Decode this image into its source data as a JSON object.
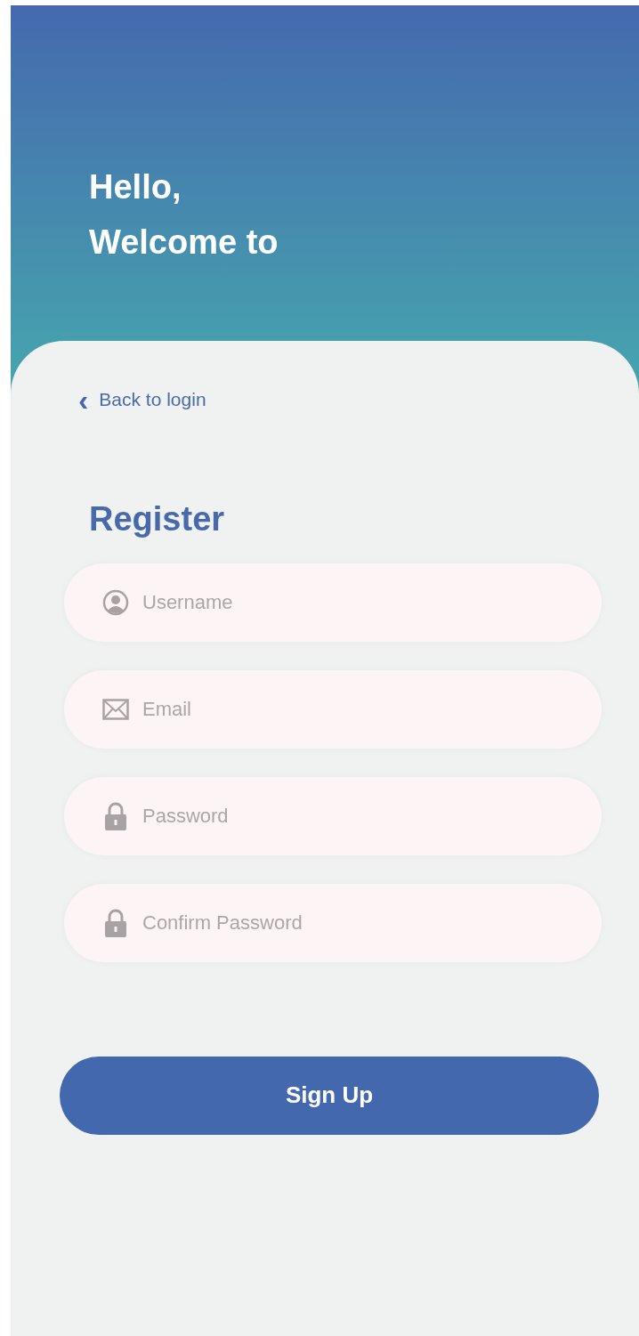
{
  "header": {
    "greeting": "Hello,",
    "welcome": "Welcome to"
  },
  "back_link": {
    "icon": "‹",
    "label": "Back to login"
  },
  "title": "Register",
  "fields": [
    {
      "kind": "user",
      "placeholder": "Username"
    },
    {
      "kind": "mail",
      "placeholder": "Email"
    },
    {
      "kind": "lock",
      "placeholder": "Password"
    },
    {
      "kind": "lock",
      "placeholder": "Confirm Password"
    }
  ],
  "submit": "Sign Up"
}
